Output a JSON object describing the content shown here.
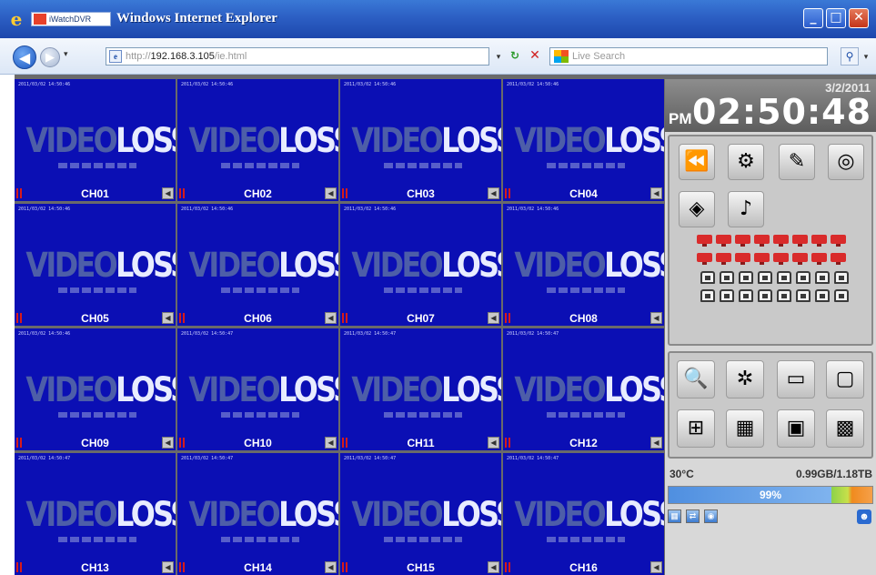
{
  "window": {
    "title": "Windows Internet Explorer",
    "app_badge": "iWatchDVR",
    "minimize": "_",
    "maximize": "□",
    "close": "✕"
  },
  "navbar": {
    "address_prefix": "http://",
    "address_host": "192.168.3.105",
    "address_suffix": "/ie.html",
    "search_placeholder": "Live Search",
    "history_arrow": "▾",
    "address_arrow": "▾",
    "search_button": "⚲",
    "search_options": "▾"
  },
  "channels": [
    {
      "label": "CH01",
      "timestamp": "2011/03/02 14:50:46"
    },
    {
      "label": "CH02",
      "timestamp": "2011/03/02 14:50:46"
    },
    {
      "label": "CH03",
      "timestamp": "2011/03/02 14:50:46"
    },
    {
      "label": "CH04",
      "timestamp": "2011/03/02 14:50:46"
    },
    {
      "label": "CH05",
      "timestamp": "2011/03/02 14:50:46"
    },
    {
      "label": "CH06",
      "timestamp": "2011/03/02 14:50:46"
    },
    {
      "label": "CH07",
      "timestamp": "2011/03/02 14:50:46"
    },
    {
      "label": "CH08",
      "timestamp": "2011/03/02 14:50:46"
    },
    {
      "label": "CH09",
      "timestamp": "2011/03/02 14:50:46"
    },
    {
      "label": "CH10",
      "timestamp": "2011/03/02 14:50:47"
    },
    {
      "label": "CH11",
      "timestamp": "2011/03/02 14:50:47"
    },
    {
      "label": "CH12",
      "timestamp": "2011/03/02 14:50:47"
    },
    {
      "label": "CH13",
      "timestamp": "2011/03/02 14:50:47"
    },
    {
      "label": "CH14",
      "timestamp": "2011/03/02 14:50:47"
    },
    {
      "label": "CH15",
      "timestamp": "2011/03/02 14:50:47"
    },
    {
      "label": "CH16",
      "timestamp": "2011/03/02 14:50:47"
    }
  ],
  "video_loss": {
    "word1": "VIDEO",
    "word2": "LOSS"
  },
  "clock": {
    "date": "3/2/2011",
    "ampm": "PM",
    "time": "02:50:48"
  },
  "status": {
    "temperature": "30°C",
    "disk": "0.99GB/1.18TB",
    "disk_usage_percent": 99,
    "disk_usage_label": "99%"
  },
  "colors": {
    "tile_bg": "#0b0fb4",
    "panel_bg": "#d8d8d8",
    "alarm": "#d92b2b"
  },
  "icons": {
    "function": [
      "playback-icon",
      "remote-config-icon",
      "log-icon",
      "snapshot-icon",
      "ptz-icon",
      "audio-icon"
    ],
    "view": [
      "search-icon",
      "settings-icon",
      "layout-single-icon",
      "layout-fullscreen-icon",
      "layout-4-icon",
      "layout-9-icon",
      "layout-13-icon",
      "layout-16-icon"
    ]
  }
}
